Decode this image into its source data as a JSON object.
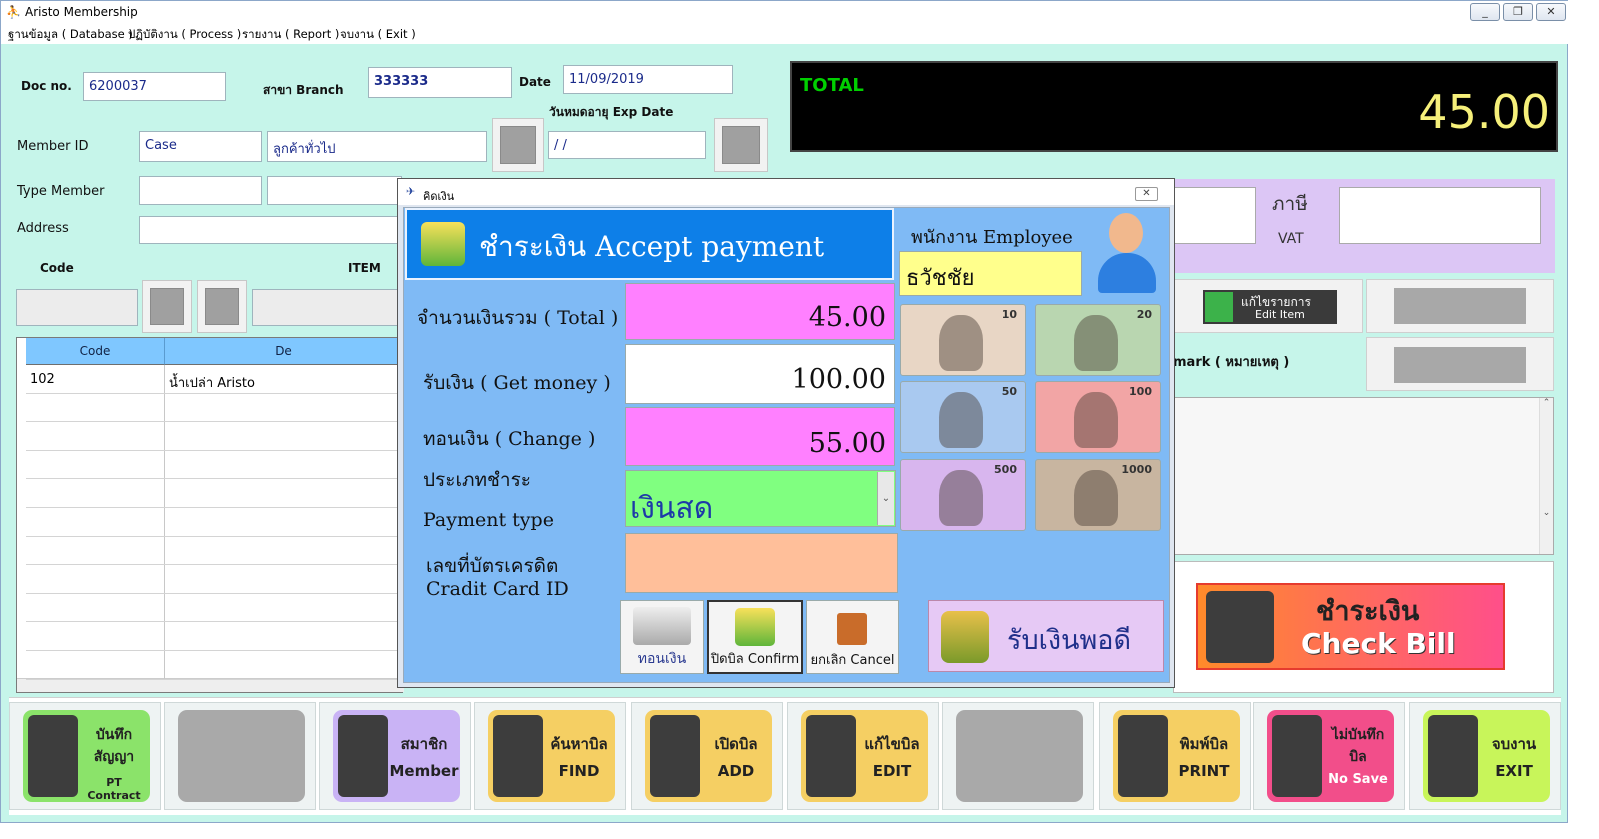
{
  "window": {
    "title": "Aristo Membership",
    "controls": [
      "_",
      "❐",
      "✕"
    ]
  },
  "menu": [
    "ฐานข้อมูล ( Database )",
    "ปฏิบัติงาน ( Process )",
    "รายงาน ( Report )",
    "จบงาน ( Exit )"
  ],
  "form": {
    "doc_label": "Doc no.",
    "doc_value": "6200037",
    "branch_label": "สาขา Branch",
    "branch_value": "333333",
    "date_label": "Date",
    "date_value": "11/09/2019",
    "exp_label": "วันหมดอายุ Exp Date",
    "exp_value": "  /  /",
    "member_label": "Member ID",
    "member_id": "Case",
    "member_name": "ลูกค้าทั่วไป",
    "type_label": "Type Member",
    "address_label": "Address",
    "code_label": "Code",
    "item_label": "ITEM"
  },
  "total": {
    "label": "TOTAL",
    "value": "45.00"
  },
  "grid": {
    "headers": [
      "Code",
      "De"
    ],
    "rows": [
      {
        "code": "102",
        "desc": "น้ำเปล่า Aristo"
      }
    ]
  },
  "right": {
    "vat_thai": "ภาษี",
    "vat_label": "VAT",
    "edit_item_th": "แก้ไขรายการ",
    "edit_item_en": "Edit Item",
    "remark_label": "mark ( หมายเหตุ )"
  },
  "checkbill": {
    "th": "ชำระเงิน",
    "en": "Check Bill"
  },
  "toolbar": [
    {
      "t1": "บันทึก สัญญา",
      "t2": "PT Contract",
      "color": "#8be36a",
      "icon": "contract-icon"
    },
    {
      "t1": "",
      "t2": "",
      "color": "#a9a9a9",
      "icon": ""
    },
    {
      "t1": "สมาชิก",
      "t2": "Member",
      "color": "#c9b3f5",
      "icon": "member-icon"
    },
    {
      "t1": "ค้นหาบิล",
      "t2": "FIND",
      "color": "#f5cf63",
      "icon": "find-bill-icon"
    },
    {
      "t1": "เปิดบิล",
      "t2": "ADD",
      "color": "#f5cf63",
      "icon": "add-bill-icon"
    },
    {
      "t1": "แก้ไขบิล",
      "t2": "EDIT",
      "color": "#f5cf63",
      "icon": "edit-bill-icon"
    },
    {
      "t1": "",
      "t2": "",
      "color": "#a9a9a9",
      "icon": ""
    },
    {
      "t1": "พิมพ์บิล",
      "t2": "PRINT",
      "color": "#f5cf63",
      "icon": "printer-icon"
    },
    {
      "t1": "ไม่บันทึก บิล",
      "t2": "No Save",
      "color": "#f24e8a",
      "icon": "no-save-icon"
    },
    {
      "t1": "จบงาน",
      "t2": "EXIT",
      "color": "#c8f55a",
      "icon": "exit-door-icon"
    }
  ],
  "dialog": {
    "title": "คิดเงิน",
    "header": "ชำระเงิน Accept payment",
    "employee_label": "พนักงาน Employee",
    "employee_name": "ธวัชชัย",
    "total_label": "จำนวนเงินรวม ( Total )",
    "total_value": "45.00",
    "get_label": "รับเงิน ( Get money )",
    "get_value": "100.00",
    "change_label": "ทอนเงิน ( Change )",
    "change_value": "55.00",
    "type_label_th": "ประเภทชำระ",
    "type_label_en": "Payment type",
    "type_value": "เงินสด",
    "card_label_th": "เลขที่บัตรเครดิต",
    "card_label_en": "Cradit Card ID",
    "btn_change": "ทอนเงิน",
    "btn_confirm": "ปิดบิล Confirm",
    "btn_cancel": "ยกเลิก Cancel",
    "btn_exact": "รับเงินพอดี",
    "notes": [
      {
        "value": "10",
        "color": "#e8d6c5"
      },
      {
        "value": "20",
        "color": "#b9d6b0"
      },
      {
        "value": "50",
        "color": "#a9c9f0"
      },
      {
        "value": "100",
        "color": "#f2a5a5"
      },
      {
        "value": "500",
        "color": "#d8b6ee"
      },
      {
        "value": "1000",
        "color": "#c8b5a0"
      }
    ]
  }
}
